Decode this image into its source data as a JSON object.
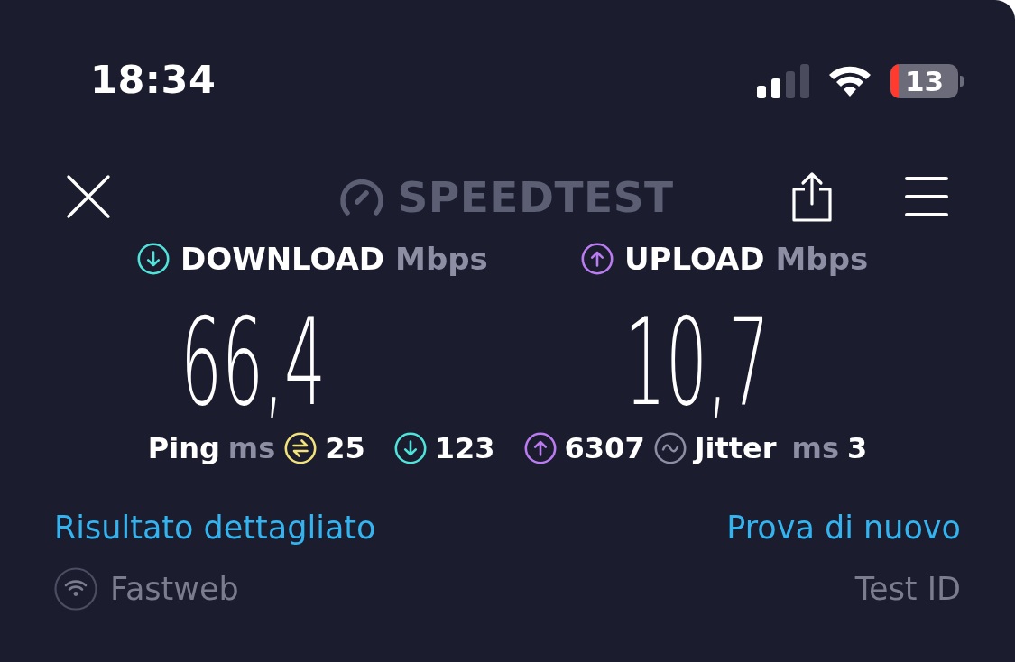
{
  "status_bar": {
    "time": "18:34",
    "battery": "13"
  },
  "header": {
    "logo": "SPEEDTEST"
  },
  "results": [
    {
      "kind": "download",
      "label": "DOWNLOAD",
      "unit": "Mbps",
      "value": "66,4",
      "color": "#4fe3da"
    },
    {
      "kind": "upload",
      "label": "UPLOAD",
      "unit": "Mbps",
      "value": "10,7",
      "color": "#bb7cf2"
    }
  ],
  "ping": {
    "label": "Ping",
    "unit": "ms",
    "items": [
      {
        "kind": "idle",
        "value": "25",
        "color": "#f2e27b"
      },
      {
        "kind": "download",
        "value": "123",
        "color": "#4fe3da"
      },
      {
        "kind": "upload",
        "value": "6307",
        "color": "#bb7cf2"
      }
    ]
  },
  "jitter": {
    "label": "Jitter",
    "unit": "ms",
    "value": "3"
  },
  "links": [
    "Risultato dettagliato",
    "Prova di nuovo"
  ],
  "footer": {
    "provider": "Fastweb",
    "test_id": "Test ID"
  }
}
